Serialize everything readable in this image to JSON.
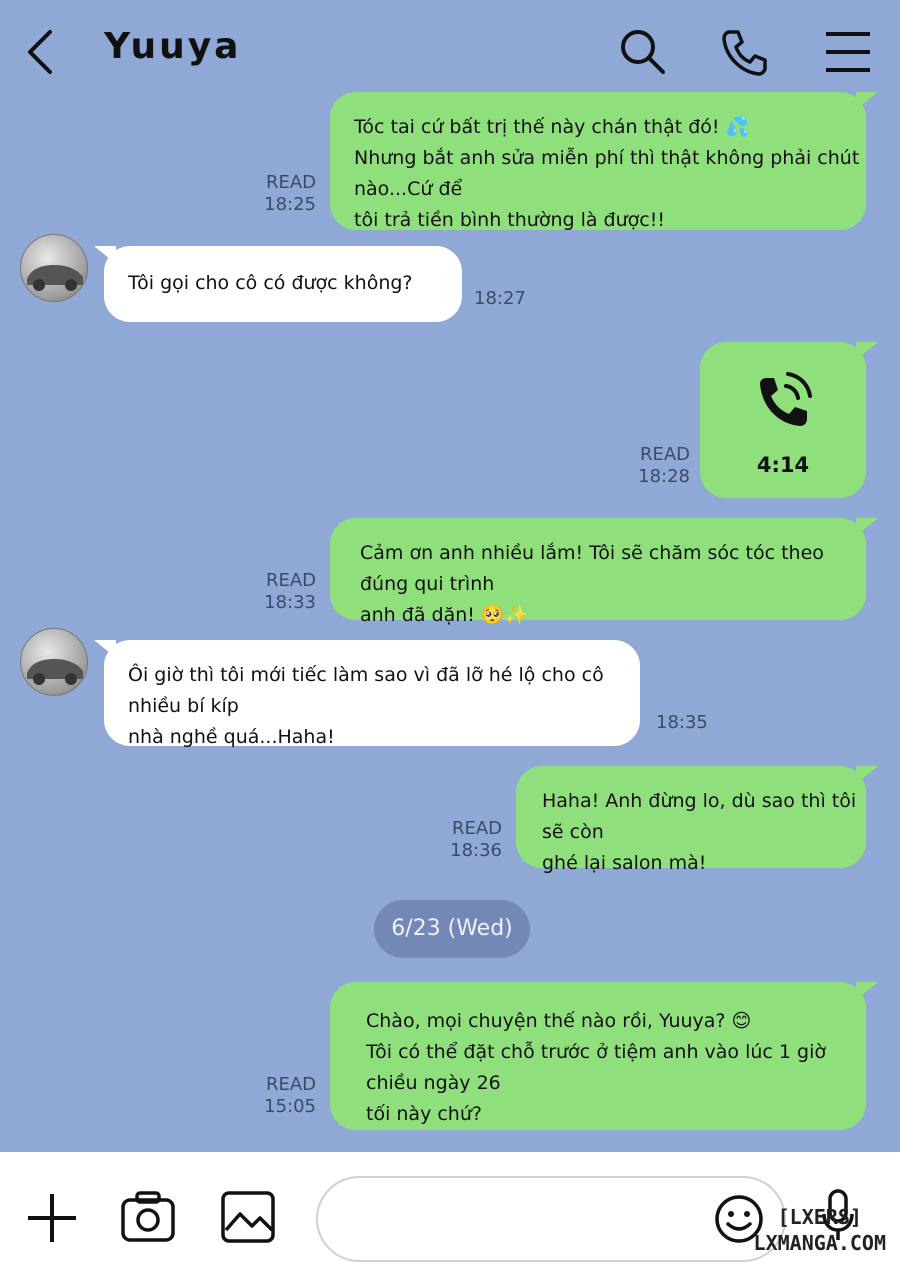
{
  "header": {
    "title": "Yuuya",
    "icons": [
      "back-chevron-icon",
      "search-icon",
      "phone-icon",
      "menu-icon"
    ]
  },
  "colors": {
    "background": "#8fa8d6",
    "outgoing_bubble": "#8fe07c",
    "incoming_bubble": "#ffffff",
    "date_pill": "#7388b7"
  },
  "messages": [
    {
      "direction": "out",
      "lines": [
        "Tóc tai cứ bất trị thế này chán thật đó! 💦",
        "Nhưng bắt anh sửa miễn phí thì thật không phải chút nào...Cứ để",
        "tôi trả tiền bình thường là được!!"
      ],
      "status": "READ",
      "time": "18:25"
    },
    {
      "direction": "in",
      "lines": [
        "Tôi gọi cho cô có được không?"
      ],
      "time": "18:27"
    },
    {
      "direction": "out",
      "type": "call",
      "duration": "4:14",
      "status": "READ",
      "time": "18:28"
    },
    {
      "direction": "out",
      "lines": [
        "Cảm ơn anh nhiều lắm! Tôi sẽ chăm sóc tóc theo đúng qui trình",
        "anh đã dặn! 🥺✨"
      ],
      "status": "READ",
      "time": "18:33"
    },
    {
      "direction": "in",
      "lines": [
        "Ôi giờ thì tôi mới tiếc làm sao vì đã lỡ hé lộ cho cô nhiều bí kíp",
        "nhà nghề quá...Haha!"
      ],
      "time": "18:35"
    },
    {
      "direction": "out",
      "lines": [
        "Haha! Anh đừng lo, dù sao thì tôi sẽ còn",
        "ghé lại salon mà!"
      ],
      "status": "READ",
      "time": "18:36"
    },
    {
      "direction": "out",
      "lines": [
        "Chào, mọi chuyện thế nào rồi, Yuuya? 😊",
        "Tôi có thể đặt chỗ trước ở tiệm anh vào lúc 1 giờ chiều ngày 26",
        "tối này chứ?"
      ],
      "status": "READ",
      "time": "15:05"
    }
  ],
  "date_divider": "6/23 (Wed)",
  "bottom_bar": {
    "icons": [
      "plus-icon",
      "camera-icon",
      "image-icon",
      "emoji-icon",
      "microphone-icon"
    ],
    "input_value": ""
  },
  "watermark": {
    "line1": "[LXERS]",
    "line2": "LXMANGA.COM"
  }
}
